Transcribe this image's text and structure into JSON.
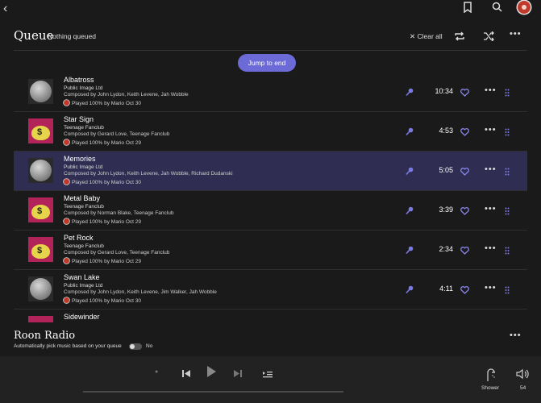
{
  "header": {
    "title": "Queue",
    "subtitle": "Nothing queued",
    "clear_label": "Clear all"
  },
  "jump_label": "Jump to end",
  "tracks": [
    {
      "title": "Albatross",
      "artist": "Public Image Ltd",
      "composer": "Composed by John Lydon, Keith Levene, Jah Wobble",
      "played": "Played 100% by Mario Oct 30",
      "duration": "10:34",
      "art": "coin"
    },
    {
      "title": "Star Sign",
      "artist": "Teenage Fanclub",
      "composer": "Composed by Gerard Love, Teenage Fanclub",
      "played": "Played 100% by Mario Oct 29",
      "duration": "4:53",
      "art": "bag"
    },
    {
      "title": "Memories",
      "artist": "Public Image Ltd",
      "composer": "Composed by John Lydon, Keith Levene, Jah Wobble, Richard Dudanski",
      "played": "Played 100% by Mario Oct 30",
      "duration": "5:05",
      "art": "coin",
      "selected": true
    },
    {
      "title": "Metal Baby",
      "artist": "Teenage Fanclub",
      "composer": "Composed by Norman Blake, Teenage Fanclub",
      "played": "Played 100% by Mario Oct 29",
      "duration": "3:39",
      "art": "bag"
    },
    {
      "title": "Pet Rock",
      "artist": "Teenage Fanclub",
      "composer": "Composed by Gerard Love, Teenage Fanclub",
      "played": "Played 100% by Mario Oct 29",
      "duration": "2:34",
      "art": "bag"
    },
    {
      "title": "Swan Lake",
      "artist": "Public Image Ltd",
      "composer": "Composed by John Lydon, Keith Levene, Jim Walker, Jah Wobble",
      "played": "Played 100% by Mario Oct 30",
      "duration": "4:11",
      "art": "coin"
    },
    {
      "title": "Sidewinder",
      "artist": "",
      "composer": "",
      "played": "",
      "duration": "",
      "art": "bag"
    }
  ],
  "radio": {
    "title": "Roon Radio",
    "description": "Automatically pick music based on your queue",
    "toggle_state": "No"
  },
  "footer": {
    "zone_label": "Shower",
    "volume": "54"
  },
  "colors": {
    "accent": "#6b6ad6",
    "selected_row": "#2f2e52",
    "background": "#1a1a1a"
  }
}
